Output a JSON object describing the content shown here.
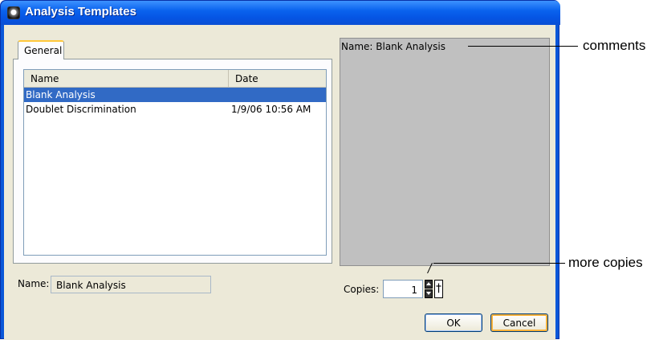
{
  "window": {
    "title": "Analysis Templates"
  },
  "tabs": [
    {
      "label": "General",
      "active": true
    }
  ],
  "template_table": {
    "columns": [
      "Name",
      "Date"
    ],
    "rows": [
      {
        "name": "Blank Analysis",
        "date": "",
        "selected": true
      },
      {
        "name": "Doublet Discrimination",
        "date": "1/9/06 10:56 AM",
        "selected": false
      }
    ]
  },
  "name_field": {
    "label": "Name:",
    "value": "Blank Analysis"
  },
  "comments": {
    "text": "Name: Blank Analysis"
  },
  "copies": {
    "label": "Copies:",
    "value": "1"
  },
  "buttons": {
    "ok": "OK",
    "cancel": "Cancel"
  },
  "callouts": {
    "comments": "comments",
    "more_copies": "more copies"
  },
  "colors": {
    "title_bar": "#0a63ee",
    "selection": "#316ac5",
    "dialog_bg": "#ece9d8",
    "comments_bg": "#c0c0c0"
  }
}
